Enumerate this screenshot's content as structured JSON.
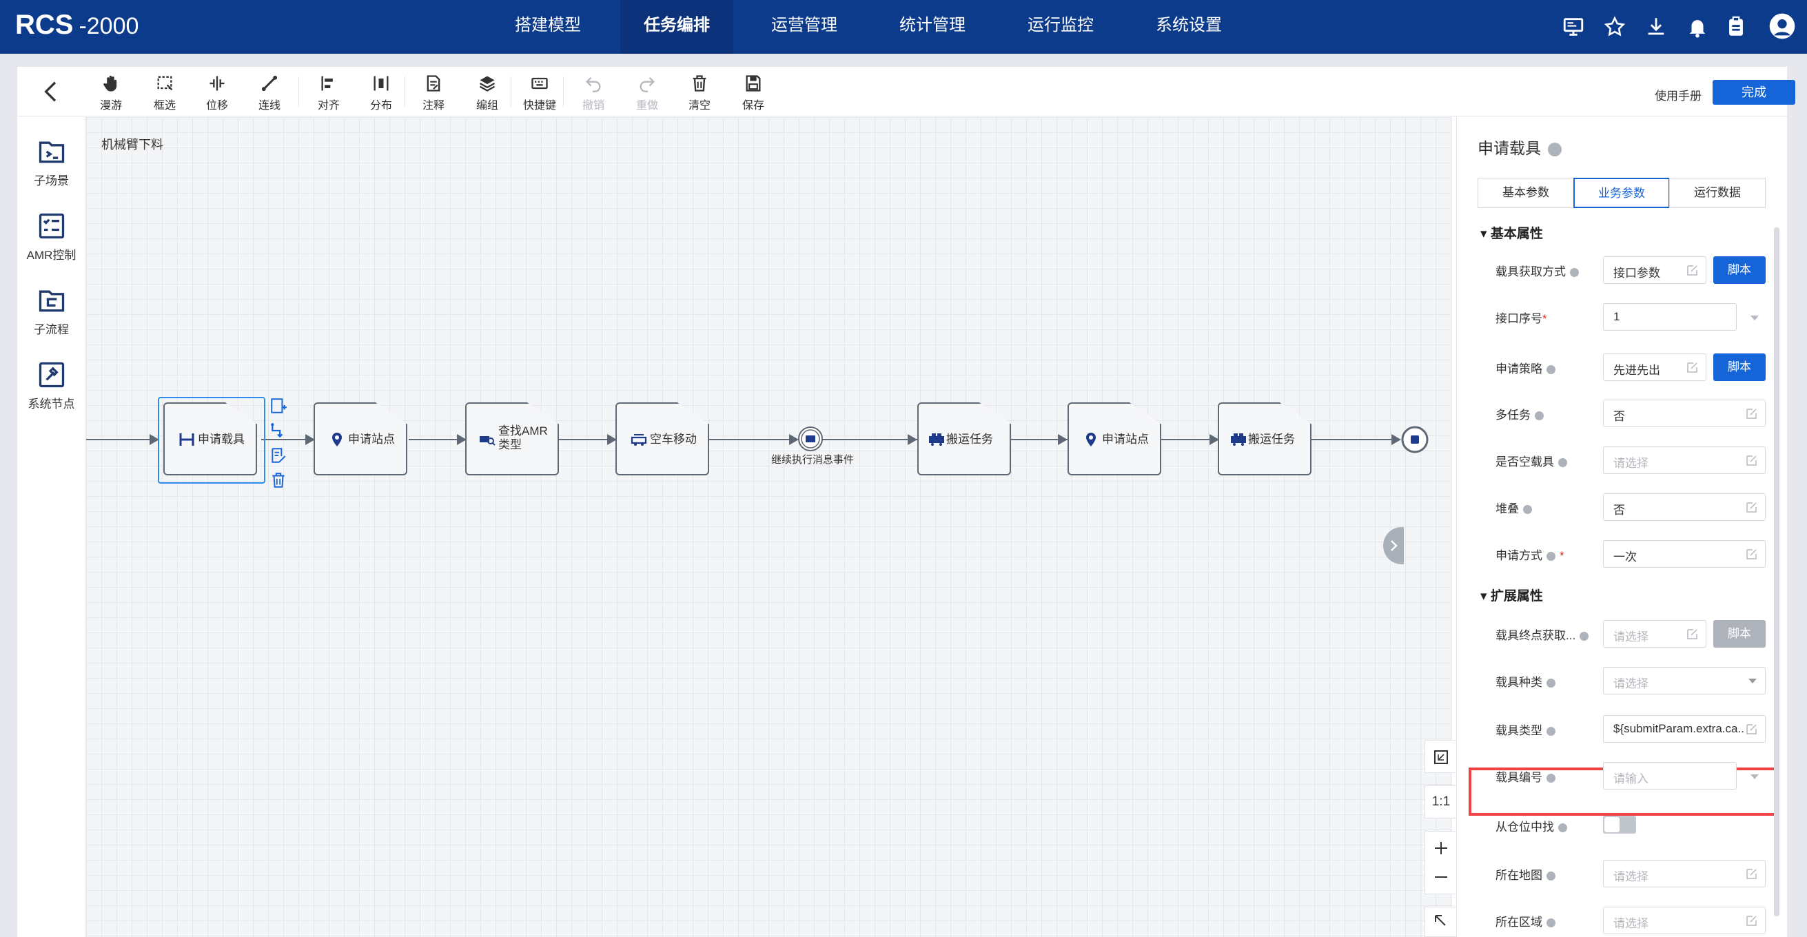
{
  "app": {
    "logo": "RCS",
    "version": "-2000"
  },
  "nav": [
    {
      "label": "搭建模型",
      "active": false
    },
    {
      "label": "任务编排",
      "active": true
    },
    {
      "label": "运营管理",
      "active": false
    },
    {
      "label": "统计管理",
      "active": false
    },
    {
      "label": "运行监控",
      "active": false
    },
    {
      "label": "系统设置",
      "active": false
    }
  ],
  "top_icons": [
    "monitor-icon",
    "star-icon",
    "download-icon",
    "bell-icon",
    "clipboard-icon",
    "user-avatar-icon"
  ],
  "toolbar": {
    "tools": [
      {
        "label": "漫游",
        "icon": "hand-icon",
        "disabled": false
      },
      {
        "label": "框选",
        "icon": "marquee-select-icon",
        "disabled": false
      },
      {
        "label": "位移",
        "icon": "move-icon",
        "disabled": false
      },
      {
        "label": "连线",
        "icon": "connect-line-icon",
        "disabled": false
      },
      {
        "label": "对齐",
        "icon": "align-icon",
        "disabled": false
      },
      {
        "label": "分布",
        "icon": "distribute-icon",
        "disabled": false
      },
      {
        "label": "注释",
        "icon": "note-icon",
        "disabled": false
      },
      {
        "label": "编组",
        "icon": "layers-icon",
        "disabled": false
      },
      {
        "label": "快捷键",
        "icon": "keyboard-icon",
        "disabled": false
      },
      {
        "label": "撤销",
        "icon": "undo-icon",
        "disabled": true
      },
      {
        "label": "重做",
        "icon": "redo-icon",
        "disabled": true
      },
      {
        "label": "清空",
        "icon": "trash-icon",
        "disabled": false
      },
      {
        "label": "保存",
        "icon": "save-icon",
        "disabled": false
      }
    ],
    "manual_label": "使用手册",
    "done_label": "完成"
  },
  "left_panel": [
    {
      "label": "子场景",
      "icon": "sub-scene-icon"
    },
    {
      "label": "AMR控制",
      "icon": "amr-control-icon"
    },
    {
      "label": "子流程",
      "icon": "sub-process-icon"
    },
    {
      "label": "系统节点",
      "icon": "system-node-icon"
    }
  ],
  "canvas": {
    "title": "机械臂下料",
    "nodes": [
      {
        "label": "申请载具",
        "icon": "carrier-icon",
        "selected": true
      },
      {
        "label": "申请站点",
        "icon": "location-pin-icon",
        "selected": false
      },
      {
        "label": "查找AMR类型",
        "line1": "查找AMR",
        "line2": "类型",
        "icon": "amr-search-icon",
        "selected": false
      },
      {
        "label": "空车移动",
        "icon": "empty-move-icon",
        "selected": false
      },
      {
        "label": "继续执行消息事件",
        "icon": "message-event-icon",
        "selected": false
      },
      {
        "label": "搬运任务",
        "icon": "transport-icon",
        "selected": false
      },
      {
        "label": "申请站点",
        "icon": "location-pin-icon",
        "selected": false
      },
      {
        "label": "搬运任务",
        "icon": "transport-icon",
        "selected": false
      }
    ],
    "node_actions": [
      "add-node-icon",
      "connect-icon",
      "edit-note-icon",
      "delete-icon"
    ],
    "controls": [
      {
        "label": "",
        "icon": "fit-screen-icon"
      },
      {
        "label": "1:1",
        "icon": ""
      },
      {
        "label": "",
        "icon": "zoom-in-icon"
      },
      {
        "label": "",
        "icon": "zoom-out-icon"
      },
      {
        "label": "",
        "icon": "minimap-icon"
      }
    ]
  },
  "panel": {
    "title": "申请载具",
    "tabs": [
      {
        "label": "基本参数",
        "active": false
      },
      {
        "label": "业务参数",
        "active": true
      },
      {
        "label": "运行数据",
        "active": false
      }
    ],
    "section1": "基本属性",
    "section2": "扩展属性",
    "script_label": "脚本",
    "fields": [
      {
        "label": "载具获取方式",
        "required": false,
        "value": "接口参数",
        "placeholder": false,
        "control": "edit",
        "script": true
      },
      {
        "label": "接口序号",
        "required": true,
        "value": "1",
        "placeholder": false,
        "control": "dropdown",
        "script": false
      },
      {
        "label": "申请策略",
        "required": false,
        "value": "先进先出",
        "placeholder": false,
        "control": "edit",
        "script": true
      },
      {
        "label": "多任务",
        "required": false,
        "value": "否",
        "placeholder": false,
        "control": "edit",
        "script": false
      },
      {
        "label": "是否空载具",
        "required": false,
        "value": "请选择",
        "placeholder": true,
        "control": "edit",
        "script": false
      },
      {
        "label": "堆叠",
        "required": false,
        "value": "否",
        "placeholder": false,
        "control": "edit",
        "script": false
      },
      {
        "label": "申请方式",
        "required": true,
        "value": "一次",
        "placeholder": false,
        "control": "edit",
        "script": false
      },
      {
        "label": "载具终点获取...",
        "required": false,
        "value": "请选择",
        "placeholder": true,
        "control": "edit",
        "script": true,
        "script_disabled": true
      },
      {
        "label": "载具种类",
        "required": false,
        "value": "请选择",
        "placeholder": true,
        "control": "dropdown",
        "script": false
      },
      {
        "label": "载具类型",
        "required": false,
        "value": "${submitParam.extra.ca...",
        "placeholder": false,
        "control": "edit",
        "script": false,
        "highlighted": true
      },
      {
        "label": "载具编号",
        "required": false,
        "value": "请输入",
        "placeholder": true,
        "control": "dropdown",
        "script": false
      },
      {
        "label": "从仓位中找",
        "required": false,
        "value": "",
        "placeholder": false,
        "control": "switch",
        "script": false
      },
      {
        "label": "所在地图",
        "required": false,
        "value": "请选择",
        "placeholder": true,
        "control": "edit",
        "script": false
      },
      {
        "label": "所在区域",
        "required": false,
        "value": "请选择",
        "placeholder": true,
        "control": "edit",
        "script": false
      }
    ]
  },
  "colors": {
    "topbar": "#0d3b8c",
    "primary": "#1565d8",
    "highlight": "#f04343",
    "node_border": "#5f6875"
  }
}
